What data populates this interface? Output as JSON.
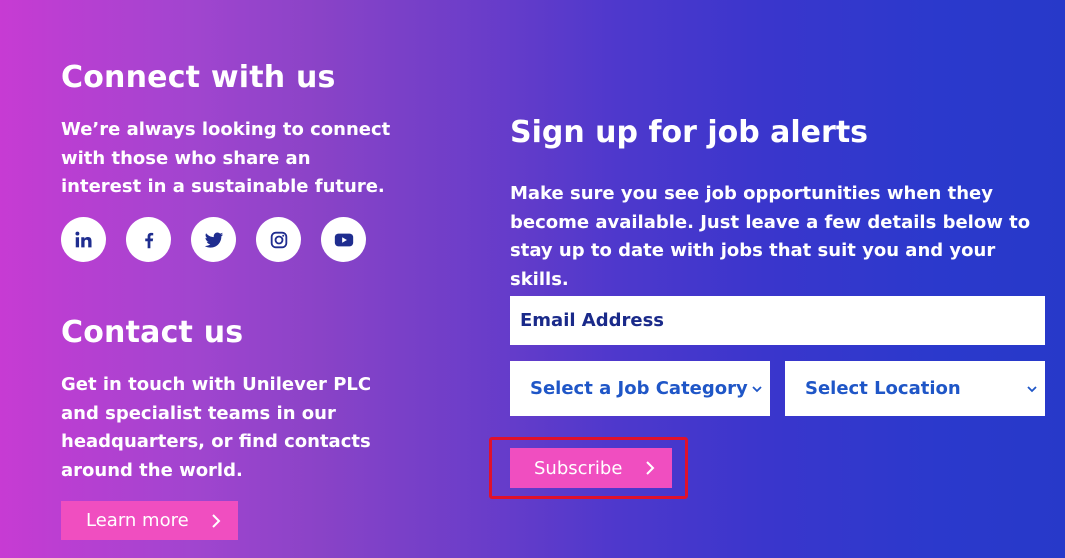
{
  "connect": {
    "title": "Connect with us",
    "body_lines": [
      "We’re always looking to connect",
      "with those who share an",
      "interest in a sustainable future."
    ],
    "social": [
      {
        "name": "linkedin-icon",
        "glyph": "in"
      },
      {
        "name": "facebook-icon",
        "glyph": "f"
      },
      {
        "name": "twitter-icon",
        "glyph": "twitter"
      },
      {
        "name": "instagram-icon",
        "glyph": "instagram"
      },
      {
        "name": "youtube-icon",
        "glyph": "youtube"
      }
    ]
  },
  "contact": {
    "title": "Contact us",
    "body_lines": [
      "Get in touch with Unilever PLC",
      "and specialist teams in our",
      "headquarters, or find contacts",
      "around the world."
    ],
    "button_label": "Learn more"
  },
  "job_alerts": {
    "title": "Sign up for job alerts",
    "body_lines": [
      "Make sure you see job opportunities when they",
      "become available. Just leave a few details below to",
      "stay up to date with jobs that suit you and your skills."
    ],
    "email_placeholder": "Email Address",
    "category_select": "Select a Job Category",
    "location_select": "Select Location",
    "subscribe_label": "Subscribe"
  },
  "colors": {
    "accent_pink": "#f04ec0",
    "icon_blue": "#1f2d8f",
    "highlight_red": "#e0112b"
  }
}
